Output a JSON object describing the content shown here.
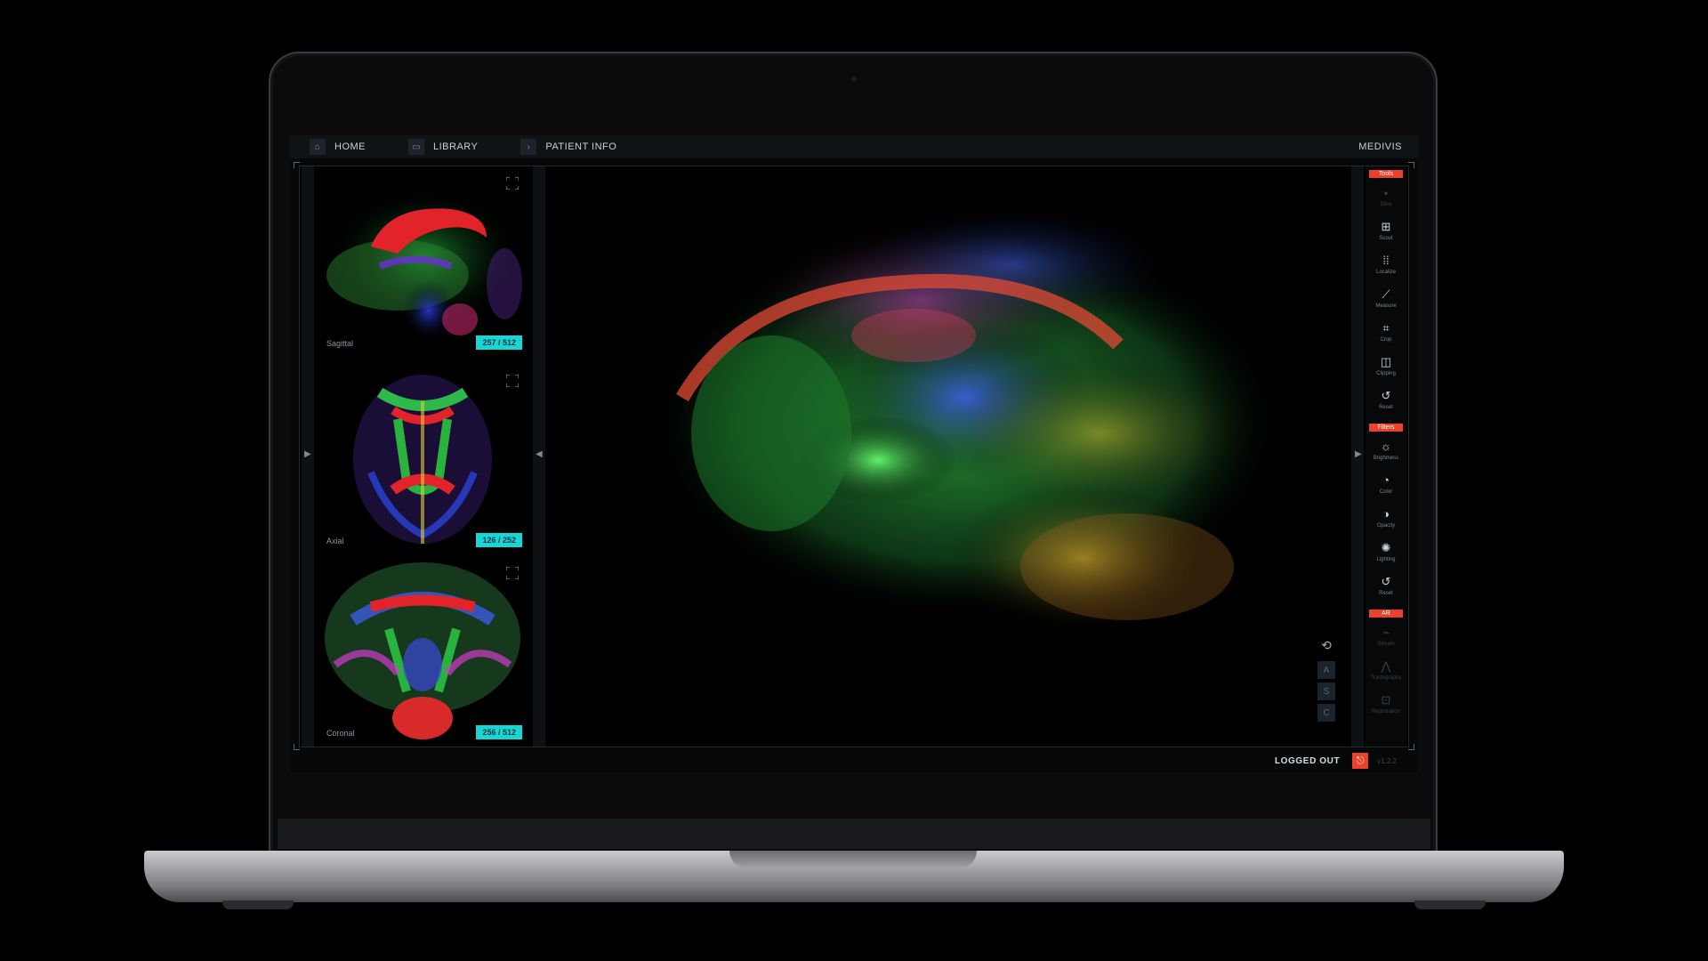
{
  "nav": {
    "home": "HOME",
    "library": "LIBRARY",
    "patient_info": "PATIENT INFO",
    "brand": "MEDIVIS"
  },
  "slices": [
    {
      "label": "Sagittal",
      "counter": "257 / 512"
    },
    {
      "label": "Axial",
      "counter": "126 / 252"
    },
    {
      "label": "Coronal",
      "counter": "256 / 512"
    }
  ],
  "view_controls": [
    "A",
    "S",
    "C"
  ],
  "tools": {
    "header": "Tools",
    "items": [
      {
        "label": "Slice",
        "icon": "pin-icon"
      },
      {
        "label": "Scout",
        "icon": "grid-icon"
      },
      {
        "label": "Localize",
        "icon": "localize-icon"
      },
      {
        "label": "Measure",
        "icon": "ruler-icon"
      },
      {
        "label": "Crop",
        "icon": "crop-icon"
      },
      {
        "label": "Clipping",
        "icon": "clipping-icon"
      },
      {
        "label": "Reset",
        "icon": "reset-icon"
      }
    ]
  },
  "filters": {
    "header": "Filters",
    "items": [
      {
        "label": "Brightness",
        "icon": "brightness-icon"
      },
      {
        "label": "Color",
        "icon": "palette-icon"
      },
      {
        "label": "Opacity",
        "icon": "opacity-icon"
      },
      {
        "label": "Lighting",
        "icon": "lighting-icon"
      },
      {
        "label": "Reset",
        "icon": "reset-icon"
      }
    ]
  },
  "ar": {
    "header": "AR",
    "items": [
      {
        "label": "Stream",
        "icon": "stream-icon"
      },
      {
        "label": "Tractography",
        "icon": "tract-icon"
      },
      {
        "label": "Registration",
        "icon": "registration-icon"
      }
    ]
  },
  "status": {
    "logged": "LOGGED OUT",
    "version": "v1.2.2"
  },
  "colors": {
    "accent": "#e8412c",
    "badge": "#19d6d6"
  }
}
